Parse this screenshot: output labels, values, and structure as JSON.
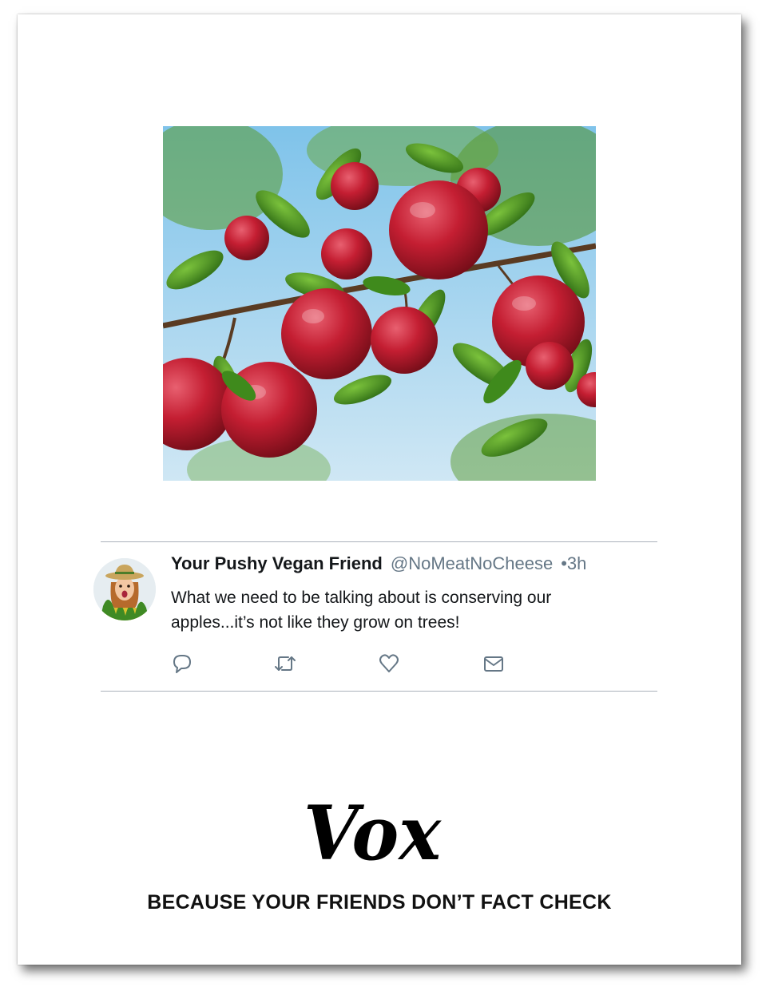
{
  "photo": {
    "subject": "apple-tree-photo"
  },
  "tweet": {
    "display_name": "Your Pushy Vegan Friend",
    "handle": "@NoMeatNoCheese",
    "time": "•3h",
    "text_line1": "What we need to be talking about is conserving our",
    "text_line2": "apples...it’s not like they grow on trees!",
    "actions": [
      "reply-icon",
      "retweet-icon",
      "like-icon",
      "message-icon"
    ],
    "accent_color": "#657786"
  },
  "brand": {
    "logo_text": "Vox",
    "tagline": "BECAUSE YOUR FRIENDS DON’T FACT CHECK"
  }
}
